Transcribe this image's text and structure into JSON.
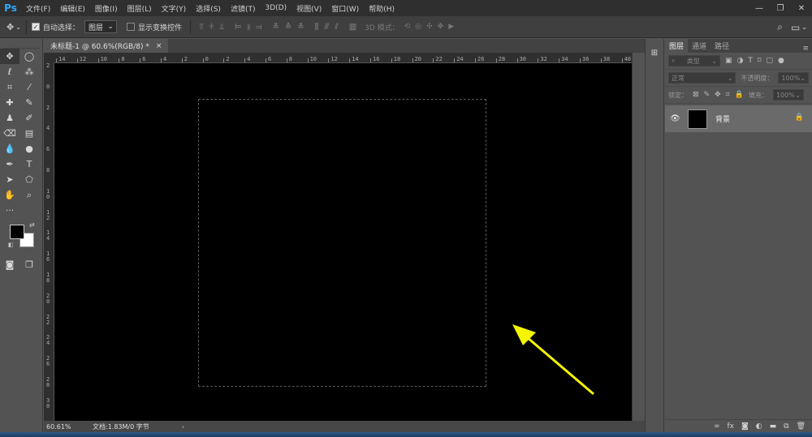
{
  "app": {
    "logo": "Ps",
    "menu": [
      "文件(F)",
      "编辑(E)",
      "图像(I)",
      "图层(L)",
      "文字(Y)",
      "选择(S)",
      "滤镜(T)",
      "3D(D)",
      "视图(V)",
      "窗口(W)",
      "帮助(H)"
    ]
  },
  "options": {
    "auto_select_label": "自动选择：",
    "auto_select_checked": true,
    "auto_select_target": "图层",
    "show_transform_label": "显示变换控件",
    "show_transform_checked": false,
    "mode3d_label": "3D 模式："
  },
  "document": {
    "tab_title": "未标题-1 @ 60.6%(RGB/8) *",
    "close_glyph": "×",
    "zoom": "60.61%",
    "doc_info": "文档:1.83M/0 字节",
    "status_chevron": "›",
    "ruler_h_ticks": [
      "14",
      "12",
      "10",
      "8",
      "6",
      "4",
      "2",
      "0",
      "2",
      "4",
      "6",
      "8",
      "10",
      "12",
      "14",
      "16",
      "18",
      "20",
      "22",
      "24",
      "26",
      "28",
      "30",
      "32",
      "34",
      "36",
      "38",
      "40"
    ],
    "ruler_v_ticks": [
      "2",
      "0",
      "2",
      "4",
      "6",
      "8",
      "10",
      "12",
      "14",
      "16",
      "18",
      "20",
      "22",
      "24",
      "26",
      "28",
      "30"
    ],
    "canvas_color": "#000000",
    "arrow_color": "#f5f500"
  },
  "layers_panel": {
    "tabs": [
      "图层",
      "通道",
      "路径"
    ],
    "active_tab": "图层",
    "filter_label": "类型",
    "blend_mode": "正常",
    "opacity_label": "不透明度：",
    "opacity_value": "100%",
    "lock_label": "锁定：",
    "fill_label": "填充：",
    "fill_value": "100%",
    "layers": [
      {
        "name": "背景",
        "visible": true,
        "locked": true,
        "thumbnail_color": "#000000"
      }
    ],
    "bottom_icons": [
      "link-icon",
      "fx-icon",
      "mask-icon",
      "adjustment-icon",
      "group-icon",
      "new-layer-icon",
      "trash-icon"
    ]
  },
  "colors": {
    "foreground": "#000000",
    "background": "#ffffff",
    "accent": "#31a8ff"
  }
}
